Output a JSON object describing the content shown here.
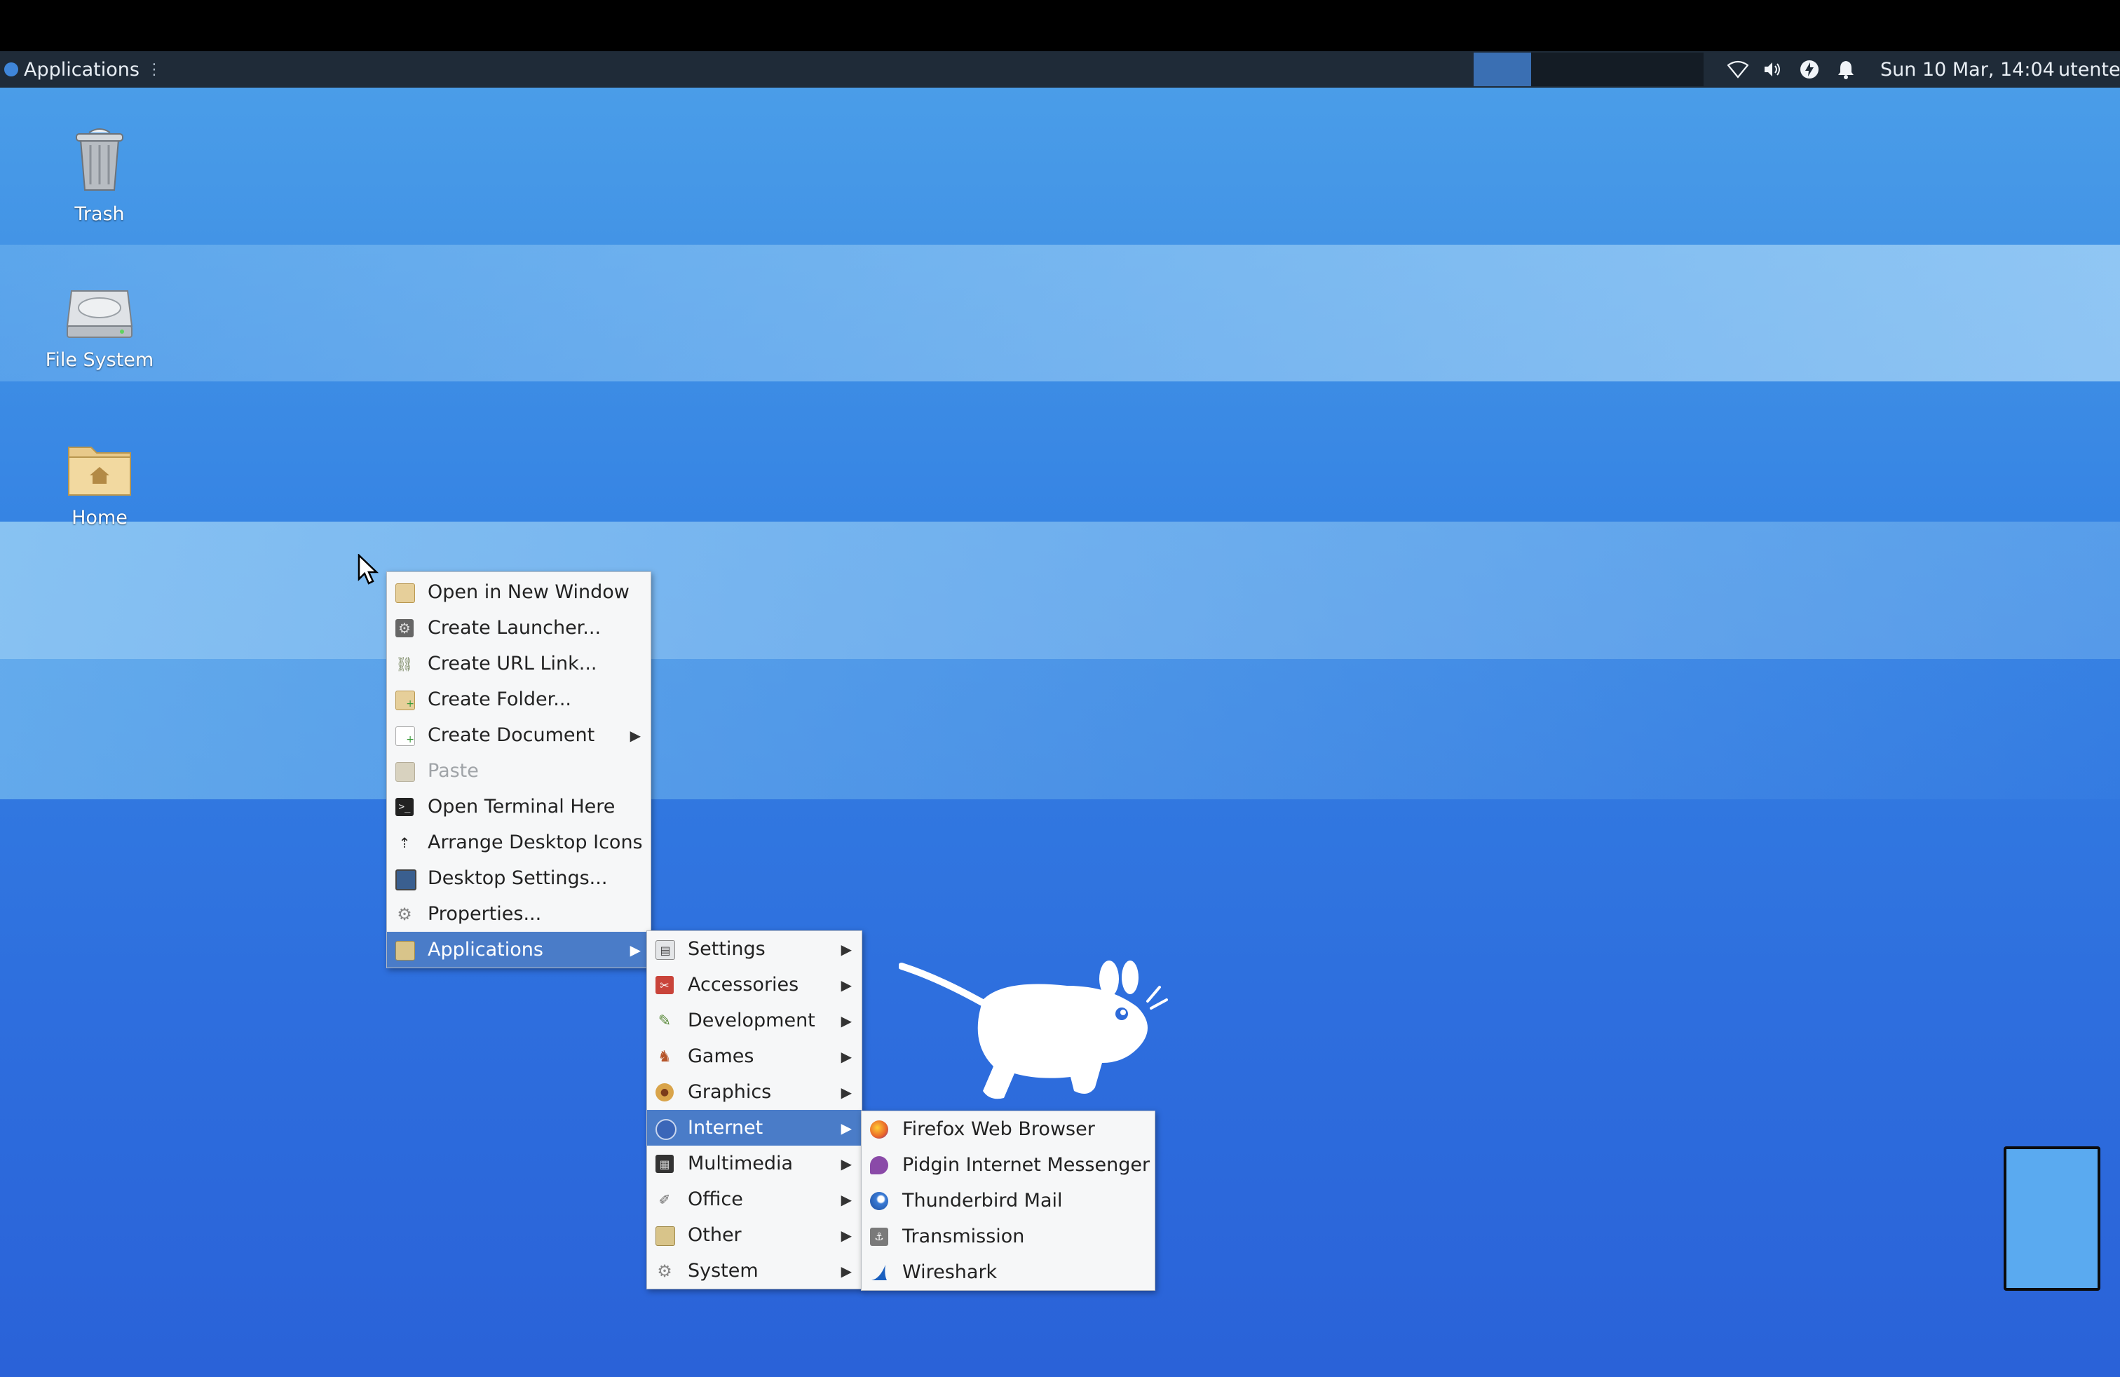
{
  "panel": {
    "applications_label": "Applications",
    "grip": "⋮",
    "clock": "Sun 10 Mar, 14:04",
    "user": "utente",
    "tray_icons": [
      "wifi-icon",
      "volume-icon",
      "power-icon",
      "bell-icon"
    ]
  },
  "desktop_icons": [
    {
      "name": "trash",
      "label": "Trash",
      "icon": "trash-icon"
    },
    {
      "name": "filesystem",
      "label": "File System",
      "icon": "harddisk-icon"
    },
    {
      "name": "home",
      "label": "Home",
      "icon": "home-folder-icon"
    }
  ],
  "context_menu": {
    "items": [
      {
        "label": "Open in New Window",
        "icon": "folder-icon"
      },
      {
        "label": "Create Launcher...",
        "icon": "launcher-icon"
      },
      {
        "label": "Create URL Link...",
        "icon": "link-icon"
      },
      {
        "label": "Create Folder...",
        "icon": "new-folder-icon"
      },
      {
        "label": "Create Document",
        "icon": "new-document-icon",
        "submenu": true
      },
      {
        "label": "Paste",
        "icon": "paste-icon",
        "disabled": true
      },
      {
        "label": "Open Terminal Here",
        "icon": "terminal-icon"
      },
      {
        "label": "Arrange Desktop Icons",
        "icon": "arrange-icon"
      },
      {
        "label": "Desktop Settings...",
        "icon": "monitor-icon"
      },
      {
        "label": "Properties...",
        "icon": "gear-icon"
      },
      {
        "label": "Applications",
        "icon": "applications-icon",
        "submenu": true,
        "selected": true
      }
    ]
  },
  "applications_menu": {
    "items": [
      {
        "label": "Settings",
        "icon": "settings-icon"
      },
      {
        "label": "Accessories",
        "icon": "accessories-icon"
      },
      {
        "label": "Development",
        "icon": "development-icon"
      },
      {
        "label": "Games",
        "icon": "games-icon"
      },
      {
        "label": "Graphics",
        "icon": "graphics-icon"
      },
      {
        "label": "Internet",
        "icon": "globe-icon",
        "selected": true
      },
      {
        "label": "Multimedia",
        "icon": "multimedia-icon"
      },
      {
        "label": "Office",
        "icon": "office-icon"
      },
      {
        "label": "Other",
        "icon": "other-icon"
      },
      {
        "label": "System",
        "icon": "system-icon"
      }
    ]
  },
  "internet_menu": {
    "items": [
      {
        "label": "Firefox Web Browser",
        "icon": "firefox-icon"
      },
      {
        "label": "Pidgin Internet Messenger",
        "icon": "pidgin-icon"
      },
      {
        "label": "Thunderbird Mail",
        "icon": "thunderbird-icon"
      },
      {
        "label": "Transmission",
        "icon": "transmission-icon"
      },
      {
        "label": "Wireshark",
        "icon": "wireshark-icon"
      }
    ]
  },
  "colors": {
    "panel_bg": "#1f2b38",
    "menu_bg": "#f6f7f8",
    "menu_selected": "#4a7cc8",
    "desktop_top": "#4a9de8",
    "desktop_bottom": "#2a62d8"
  }
}
